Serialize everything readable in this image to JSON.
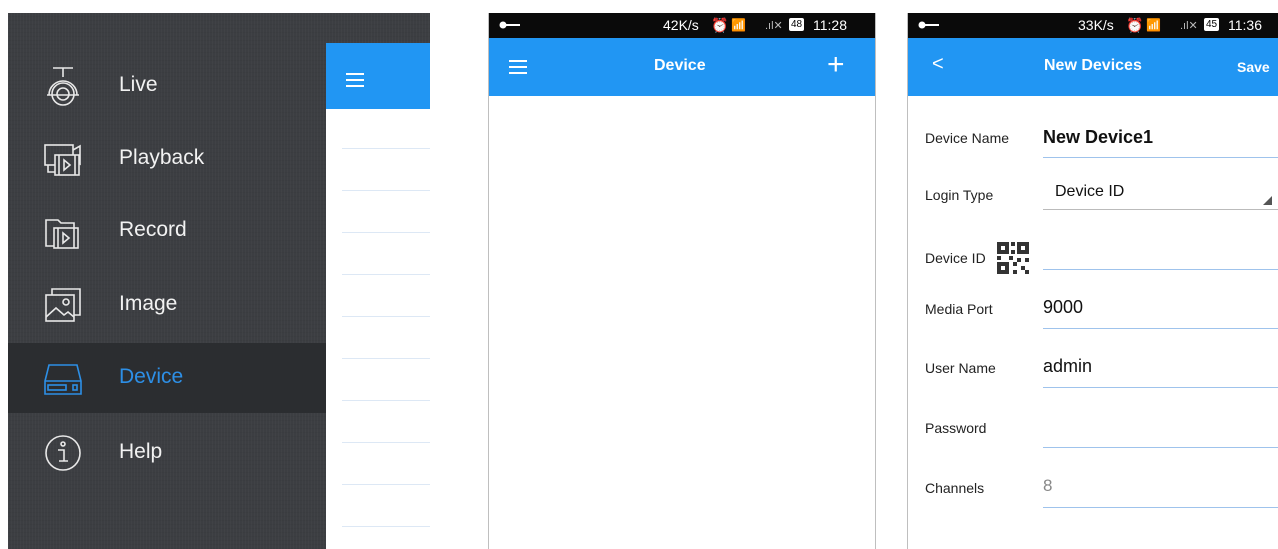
{
  "menu": {
    "items": [
      {
        "label": "Live",
        "icon": "camera-icon"
      },
      {
        "label": "Playback",
        "icon": "playback-icon"
      },
      {
        "label": "Record",
        "icon": "record-icon"
      },
      {
        "label": "Image",
        "icon": "image-icon"
      },
      {
        "label": "Device",
        "icon": "device-icon",
        "selected": true
      },
      {
        "label": "Help",
        "icon": "help-icon"
      }
    ]
  },
  "device_list": {
    "status": {
      "speed": "42K/s",
      "battery": "48",
      "time": "11:28"
    },
    "title": "Device",
    "add_label": "+"
  },
  "new_device": {
    "status": {
      "speed": "33K/s",
      "battery": "45",
      "time": "11:36"
    },
    "title": "New Devices",
    "back_label": "<",
    "save_label": "Save",
    "fields": {
      "device_name": {
        "label": "Device Name",
        "value": "New Device1"
      },
      "login_type": {
        "label": "Login Type",
        "value": "Device ID"
      },
      "device_id": {
        "label": "Device ID",
        "value": ""
      },
      "media_port": {
        "label": "Media Port",
        "value": "9000"
      },
      "user_name": {
        "label": "User Name",
        "value": "admin"
      },
      "password": {
        "label": "Password",
        "value": ""
      },
      "channels": {
        "label": "Channels",
        "value": "8"
      }
    }
  },
  "colors": {
    "accent": "#2196f3",
    "selected_text": "#2d8fe6",
    "menu_bg": "#3c3e42"
  }
}
